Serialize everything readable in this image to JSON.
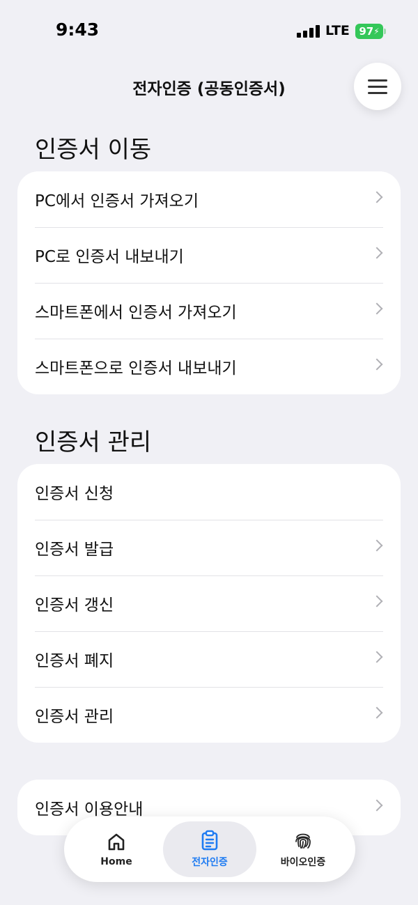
{
  "status_bar": {
    "time": "9:43",
    "network": "LTE",
    "battery": "97"
  },
  "header": {
    "title": "전자인증 (공동인증서)",
    "menu_icon": "hamburger-menu-icon"
  },
  "sections": [
    {
      "title": "인증서 이동",
      "items": [
        {
          "label": "PC에서 인증서 가져오기",
          "chevron": true
        },
        {
          "label": "PC로 인증서 내보내기",
          "chevron": true
        },
        {
          "label": "스마트폰에서 인증서 가져오기",
          "chevron": true
        },
        {
          "label": "스마트폰으로 인증서 내보내기",
          "chevron": true
        }
      ]
    },
    {
      "title": "인증서 관리",
      "items": [
        {
          "label": "인증서 신청",
          "chevron": false
        },
        {
          "label": "인증서 발급",
          "chevron": true
        },
        {
          "label": "인증서 갱신",
          "chevron": true
        },
        {
          "label": "인증서 폐지",
          "chevron": true
        },
        {
          "label": "인증서 관리",
          "chevron": true
        }
      ]
    }
  ],
  "info_row": {
    "label": "인증서 이용안내",
    "chevron": true
  },
  "tab_bar": {
    "tabs": [
      {
        "label": "Home",
        "icon": "home-icon",
        "active": false
      },
      {
        "label": "전자인증",
        "icon": "clipboard-icon",
        "active": true
      },
      {
        "label": "바이오인증",
        "icon": "fingerprint-icon",
        "active": false
      }
    ]
  },
  "colors": {
    "background": "#F0F0F5",
    "accent": "#1E7BF2",
    "battery": "#34C759"
  }
}
